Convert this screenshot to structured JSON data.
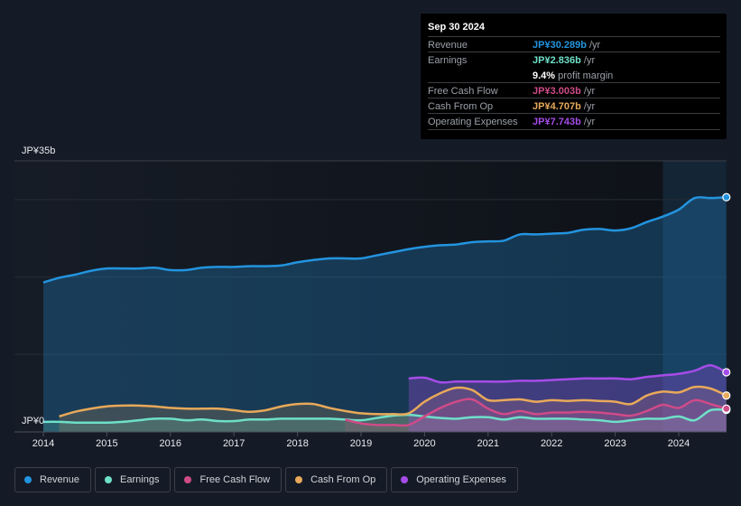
{
  "tooltip": {
    "date": "Sep 30 2024",
    "rows": [
      {
        "label": "Revenue",
        "value": "JP¥30.289b",
        "unit": " /yr",
        "color": "#2394df"
      },
      {
        "label": "Earnings",
        "value": "JP¥2.836b",
        "unit": " /yr",
        "color": "#6ee0c8"
      },
      {
        "label": "Free Cash Flow",
        "value": "JP¥3.003b",
        "unit": " /yr",
        "color": "#cf4b88"
      },
      {
        "label": "Cash From Op",
        "value": "JP¥4.707b",
        "unit": " /yr",
        "color": "#e8a95a"
      },
      {
        "label": "Operating Expenses",
        "value": "JP¥7.743b",
        "unit": " /yr",
        "color": "#a64ce8"
      }
    ],
    "margin_value": "9.4%",
    "margin_text": " profit margin"
  },
  "legend": [
    {
      "label": "Revenue",
      "color": "#2394df"
    },
    {
      "label": "Earnings",
      "color": "#6ee0c8"
    },
    {
      "label": "Free Cash Flow",
      "color": "#cf4b88"
    },
    {
      "label": "Cash From Op",
      "color": "#e8a95a"
    },
    {
      "label": "Operating Expenses",
      "color": "#a64ce8"
    }
  ],
  "chart_data": {
    "type": "area",
    "title": "",
    "xlabel": "",
    "ylabel": "",
    "y_top_label": "JP¥35b",
    "y_zero_label": "JP¥0",
    "ylim": [
      0,
      35
    ],
    "xlim": [
      2014,
      2024.75
    ],
    "x_ticks": [
      "2014",
      "2015",
      "2016",
      "2017",
      "2018",
      "2019",
      "2020",
      "2021",
      "2022",
      "2023",
      "2024"
    ],
    "forecast_highlight_start": 2023.75,
    "series": [
      {
        "name": "Revenue",
        "color": "#2394df",
        "x": [
          2014,
          2014.25,
          2014.5,
          2014.75,
          2015,
          2015.25,
          2015.5,
          2015.75,
          2016,
          2016.25,
          2016.5,
          2016.75,
          2017,
          2017.25,
          2017.5,
          2017.75,
          2018,
          2018.25,
          2018.5,
          2018.75,
          2019,
          2019.25,
          2019.5,
          2019.75,
          2020,
          2020.25,
          2020.5,
          2020.75,
          2021,
          2021.25,
          2021.5,
          2021.75,
          2022,
          2022.25,
          2022.5,
          2022.75,
          2023,
          2023.25,
          2023.5,
          2023.75,
          2024,
          2024.25,
          2024.5,
          2024.75
        ],
        "values": [
          19.3,
          19.9,
          20.3,
          20.8,
          21.1,
          21.1,
          21.1,
          21.2,
          20.9,
          20.9,
          21.2,
          21.3,
          21.3,
          21.4,
          21.4,
          21.5,
          21.9,
          22.2,
          22.4,
          22.4,
          22.4,
          22.8,
          23.2,
          23.6,
          23.9,
          24.1,
          24.2,
          24.5,
          24.6,
          24.7,
          25.5,
          25.5,
          25.6,
          25.7,
          26.1,
          26.2,
          26.0,
          26.3,
          27.1,
          27.8,
          28.7,
          30.2,
          30.2,
          30.3
        ]
      },
      {
        "name": "Earnings",
        "color": "#6ee0c8",
        "x": [
          2014,
          2014.25,
          2014.5,
          2014.75,
          2015,
          2015.25,
          2015.5,
          2015.75,
          2016,
          2016.25,
          2016.5,
          2016.75,
          2017,
          2017.25,
          2017.5,
          2017.75,
          2018,
          2018.25,
          2018.5,
          2018.75,
          2019,
          2019.25,
          2019.5,
          2019.75,
          2020,
          2020.25,
          2020.5,
          2020.75,
          2021,
          2021.25,
          2021.5,
          2021.75,
          2022,
          2022.25,
          2022.5,
          2022.75,
          2023,
          2023.25,
          2023.5,
          2023.75,
          2024,
          2024.25,
          2024.5,
          2024.75
        ],
        "values": [
          1.3,
          1.3,
          1.2,
          1.2,
          1.2,
          1.3,
          1.5,
          1.7,
          1.7,
          1.5,
          1.6,
          1.4,
          1.4,
          1.6,
          1.6,
          1.7,
          1.7,
          1.7,
          1.7,
          1.6,
          1.5,
          1.8,
          2.1,
          2.2,
          2.0,
          1.8,
          1.7,
          1.9,
          1.9,
          1.6,
          1.9,
          1.7,
          1.7,
          1.7,
          1.6,
          1.5,
          1.3,
          1.5,
          1.7,
          1.7,
          2.0,
          1.5,
          2.8,
          2.84
        ]
      },
      {
        "name": "Free Cash Flow",
        "color": "#cf4b88",
        "x": [
          2018.75,
          2019,
          2019.25,
          2019.5,
          2019.75,
          2020,
          2020.25,
          2020.5,
          2020.75,
          2021,
          2021.25,
          2021.5,
          2021.75,
          2022,
          2022.25,
          2022.5,
          2022.75,
          2023,
          2023.25,
          2023.5,
          2023.75,
          2024,
          2024.25,
          2024.5,
          2024.75
        ],
        "values": [
          1.6,
          1.1,
          0.9,
          0.9,
          0.9,
          2.0,
          3.1,
          3.9,
          4.2,
          3.0,
          2.3,
          2.7,
          2.3,
          2.5,
          2.5,
          2.6,
          2.5,
          2.3,
          2.1,
          2.7,
          3.5,
          3.1,
          4.1,
          3.6,
          3.0
        ]
      },
      {
        "name": "Cash From Op",
        "color": "#e8a95a",
        "x": [
          2014.25,
          2014.5,
          2014.75,
          2015,
          2015.25,
          2015.5,
          2015.75,
          2016,
          2016.25,
          2016.5,
          2016.75,
          2017,
          2017.25,
          2017.5,
          2017.75,
          2018,
          2018.25,
          2018.5,
          2018.75,
          2019,
          2019.25,
          2019.5,
          2019.75,
          2020,
          2020.25,
          2020.5,
          2020.75,
          2021,
          2021.25,
          2021.5,
          2021.75,
          2022,
          2022.25,
          2022.5,
          2022.75,
          2023,
          2023.25,
          2023.5,
          2023.75,
          2024,
          2024.25,
          2024.5,
          2024.75
        ],
        "values": [
          2.0,
          2.6,
          3.0,
          3.3,
          3.4,
          3.4,
          3.3,
          3.1,
          3.0,
          3.0,
          3.0,
          2.8,
          2.6,
          2.8,
          3.3,
          3.6,
          3.6,
          3.1,
          2.7,
          2.4,
          2.3,
          2.3,
          2.4,
          3.9,
          5.0,
          5.7,
          5.4,
          4.1,
          4.1,
          4.2,
          3.9,
          4.1,
          4.0,
          4.1,
          4.0,
          3.9,
          3.6,
          4.7,
          5.2,
          5.1,
          5.8,
          5.6,
          4.7
        ]
      },
      {
        "name": "Operating Expenses",
        "color": "#a64ce8",
        "x": [
          2019.75,
          2020,
          2020.25,
          2020.5,
          2020.75,
          2021,
          2021.25,
          2021.5,
          2021.75,
          2022,
          2022.25,
          2022.5,
          2022.75,
          2023,
          2023.25,
          2023.5,
          2023.75,
          2024,
          2024.25,
          2024.5,
          2024.75
        ],
        "values": [
          6.9,
          7.0,
          6.4,
          6.5,
          6.5,
          6.5,
          6.5,
          6.6,
          6.6,
          6.7,
          6.8,
          6.9,
          6.9,
          6.9,
          6.8,
          7.1,
          7.3,
          7.5,
          7.9,
          8.6,
          7.7
        ]
      }
    ]
  }
}
